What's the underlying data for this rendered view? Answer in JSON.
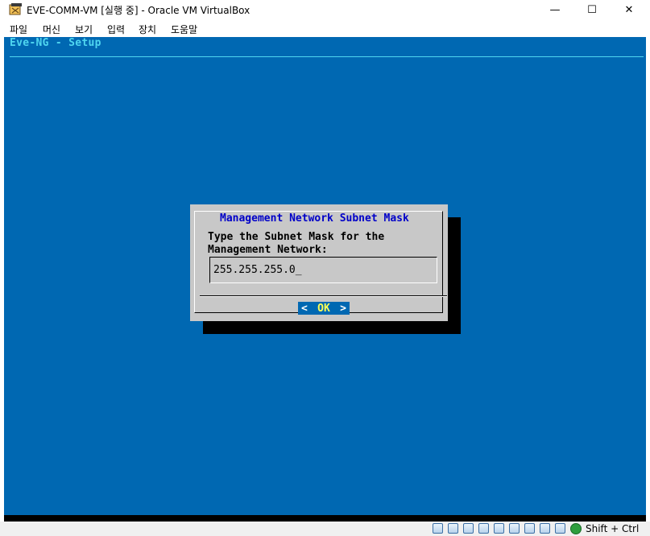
{
  "window": {
    "title": "EVE-COMM-VM [실행 중] - Oracle VM VirtualBox",
    "minimize_glyph": "—",
    "maximize_glyph": "☐",
    "close_glyph": "✕"
  },
  "menubar": {
    "items": [
      "파일",
      "머신",
      "보기",
      "입력",
      "장치",
      "도움말"
    ]
  },
  "console": {
    "header": "Eve-NG - Setup",
    "background": "#0068b2",
    "header_color": "#4fd6f0"
  },
  "dialog": {
    "title": "Management Network Subnet Mask",
    "prompt_line1": "Type the Subnet Mask for the",
    "prompt_line2": "Management Network:",
    "input_value": "255.255.255.0_",
    "ok_left": "<",
    "ok_label": "OK",
    "ok_right": ">",
    "title_color": "#0000c8",
    "button_color": "#0068b2"
  },
  "statusbar": {
    "host_key": "Shift + Ctrl",
    "icons": [
      "hard-disk-icon",
      "optical-drive-icon",
      "audio-icon",
      "network-icon",
      "usb-icon",
      "shared-folders-icon",
      "display-icon",
      "video-capture-icon",
      "cpu-icon",
      "mouse-integration-icon",
      "keyboard-icon"
    ]
  }
}
